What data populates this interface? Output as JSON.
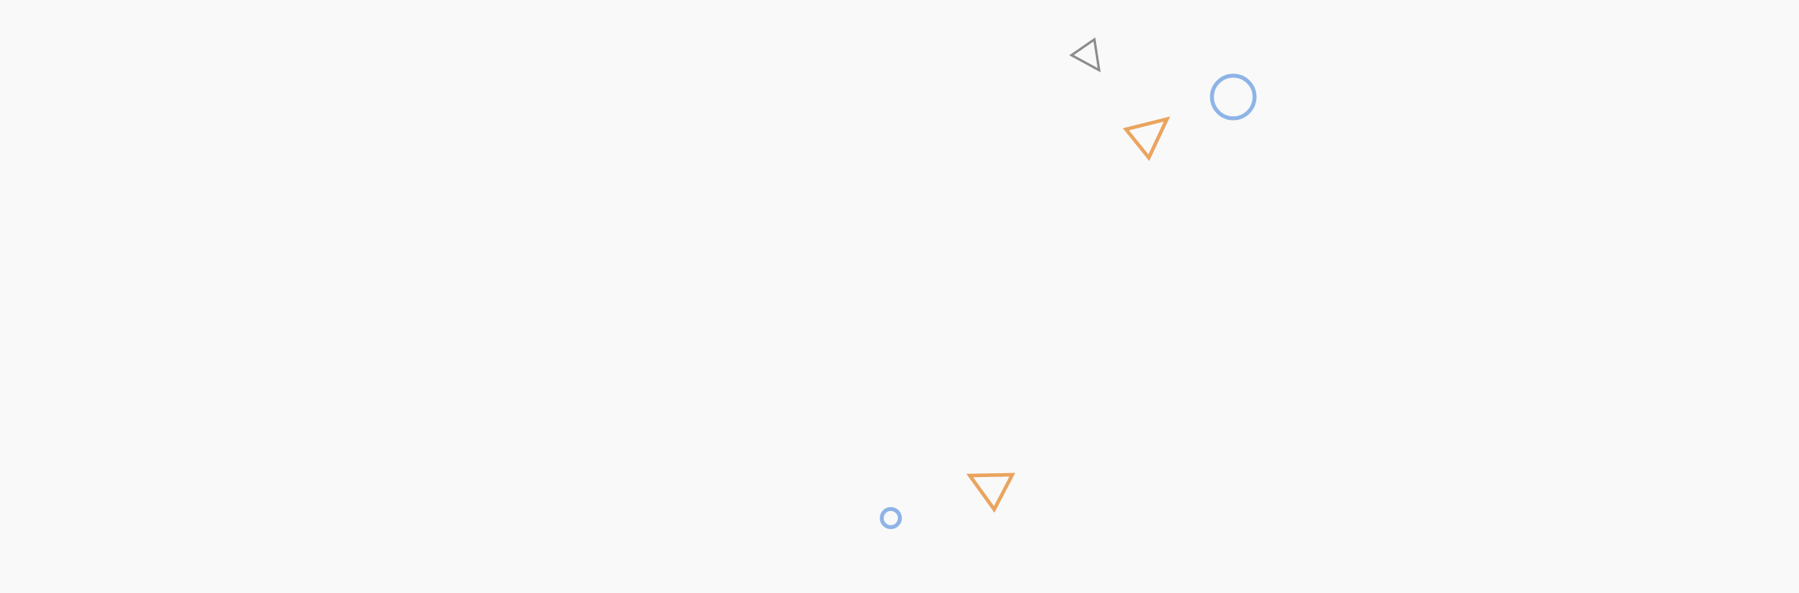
{
  "background_color": "#f9f9fa",
  "shapes": [
    {
      "kind": "triangle-outline",
      "icon": "triangle-icon",
      "color": "#8c8c8c"
    },
    {
      "kind": "circle-outline",
      "icon": "circle-icon",
      "color": "#8eb4e6"
    },
    {
      "kind": "triangle-outline",
      "icon": "triangle-icon",
      "color": "#eaa45e"
    },
    {
      "kind": "circle-outline",
      "icon": "circle-icon",
      "color": "#8eb4e6"
    },
    {
      "kind": "triangle-outline",
      "icon": "triangle-icon",
      "color": "#eaa45e"
    }
  ]
}
